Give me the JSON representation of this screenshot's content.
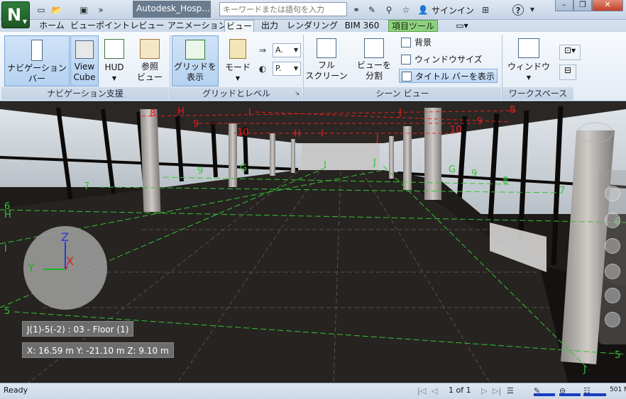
{
  "titlebar": {
    "app_logo": "N",
    "doc_title": "Autodesk_Hosp...",
    "search_placeholder": "キーワードまたは語句を入力",
    "signin": "サインイン"
  },
  "tabs": [
    {
      "label": "ホーム"
    },
    {
      "label": "ビューポイント"
    },
    {
      "label": "レビュー"
    },
    {
      "label": "アニメーション"
    },
    {
      "label": "ビュー",
      "active": true
    },
    {
      "label": "出力"
    },
    {
      "label": "レンダリング"
    },
    {
      "label": "BIM 360"
    },
    {
      "label": "項目ツール",
      "context": true
    }
  ],
  "ribbon": {
    "nav": {
      "navigation_bar": "ナビゲーション\nバー",
      "view_cube": "View\nCube",
      "hud": "HUD",
      "reference_view": "参照\nビュー",
      "label": "ナビゲーション支援"
    },
    "grid": {
      "show_grid": "グリッドを\n表示",
      "mode": "モード",
      "drop_a": "A.",
      "drop_p": "P.",
      "label": "グリッドとレベル"
    },
    "scene": {
      "full_screen": "フル\nスクリーン",
      "split_view": "ビューを\n分割",
      "background": "背景",
      "window_size": "ウィンドウサイズ",
      "show_title_bar": "タイトル バーを表示",
      "label": "シーン ビュー"
    },
    "workspace": {
      "windows": "ウィンドウ",
      "label": "ワークスペース"
    }
  },
  "viewport": {
    "location": "J(1)-5(-2) : 03 - Floor (1)",
    "coordinates": "X: 16.59 m  Y: -21.10 m  Z: 9.10 m",
    "axis": {
      "x": "X",
      "y": "Y",
      "z": "Z"
    },
    "grid_labels": {
      "red": [
        "8",
        "H",
        "9",
        "I",
        "10",
        "H",
        "I",
        "J",
        "J",
        "10",
        "9",
        "8"
      ],
      "green": [
        "7",
        "9",
        "G",
        "I",
        "J",
        "G",
        "9",
        "8",
        "7",
        "6",
        "H",
        "I",
        "5",
        "5",
        "J",
        "6"
      ]
    },
    "colors": {
      "grid_red": "#e82020",
      "grid_green": "#36c236"
    }
  },
  "status": {
    "text": "Ready",
    "page": "1 of 1",
    "memory": "501 M"
  }
}
